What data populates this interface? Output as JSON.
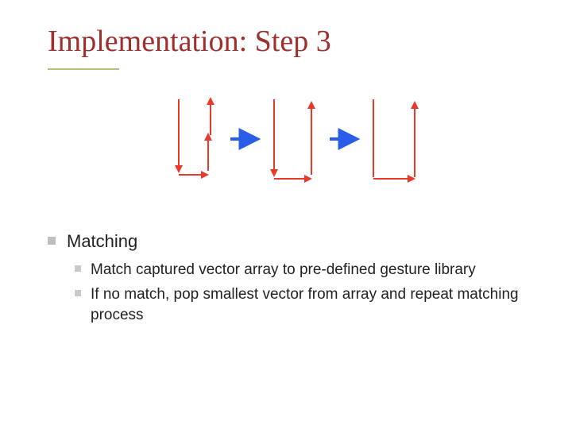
{
  "title": "Implementation: Step 3",
  "bullets": {
    "l1": "Matching",
    "l2a": "Match captured vector array to pre-defined gesture library",
    "l2b": "If no match, pop smallest vector from array and repeat matching process"
  },
  "colors": {
    "title": "#9e2f2f",
    "rule": "#b9bd7a",
    "arrow_red": "#e83a2a",
    "arrow_blue": "#2a5de8",
    "bullet_square": "#bfbfbf"
  }
}
